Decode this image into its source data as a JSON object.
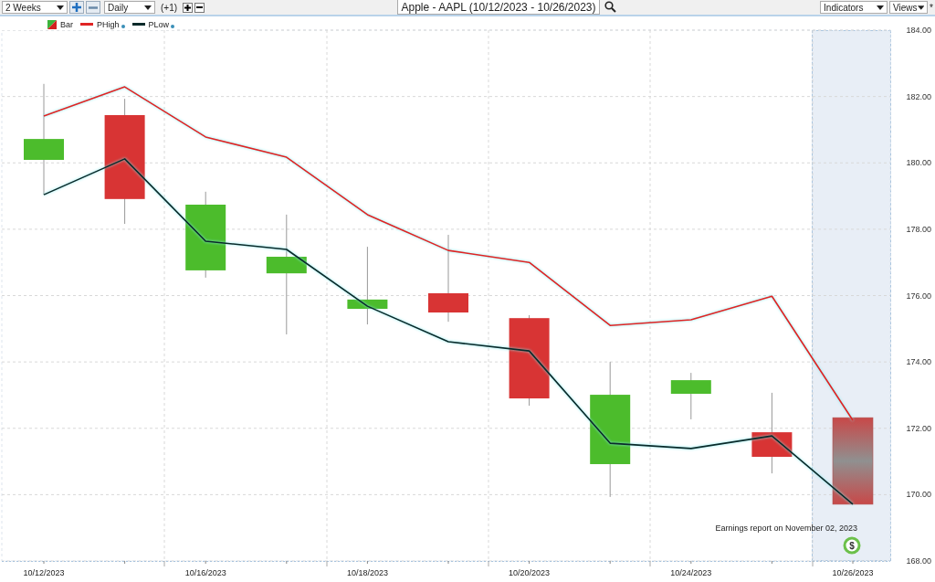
{
  "toolbar": {
    "range": "2 Weeks",
    "interval": "Daily",
    "offset": "(+1)",
    "title": "Apple - AAPL (10/12/2023 - 10/26/2023)",
    "indicators": "Indicators",
    "views": "Views",
    "modified_mark": "*"
  },
  "chart": {
    "bar_legend": "Bar",
    "chart_data": {
      "type": "line",
      "categories": [
        "10/12/2023",
        null,
        "10/16/2023",
        null,
        "10/18/2023",
        null,
        "10/20/2023",
        null,
        "10/24/2023",
        null,
        "10/26/2023"
      ],
      "ylim": [
        168,
        184
      ],
      "yticks": [
        {
          "value": 184,
          "label": "184.00"
        },
        {
          "value": 182,
          "label": "182.00"
        },
        {
          "value": 180,
          "label": "180.00"
        },
        {
          "value": 178,
          "label": "178.00"
        },
        {
          "value": 176,
          "label": "176.00"
        },
        {
          "value": 174,
          "label": "174.00"
        },
        {
          "value": 172,
          "label": "172.00"
        },
        {
          "value": 170,
          "label": "170.00"
        },
        {
          "value": 168,
          "label": "168.00"
        }
      ],
      "grid": true,
      "series": [
        {
          "name": "PHigh",
          "color": "#e02424",
          "values": [
            181.41,
            182.29,
            180.78,
            180.17,
            178.44,
            177.36,
            177.0,
            175.1,
            175.27,
            175.98,
            172.24
          ]
        },
        {
          "name": "PLow",
          "color": "#0a2a2a",
          "values": [
            179.04,
            180.12,
            177.64,
            177.39,
            175.68,
            174.61,
            174.33,
            171.55,
            171.39,
            171.77,
            169.71
          ]
        }
      ]
    },
    "annotation": {
      "text": "Earnings report on November 02, 2023",
      "badge": "$"
    }
  }
}
